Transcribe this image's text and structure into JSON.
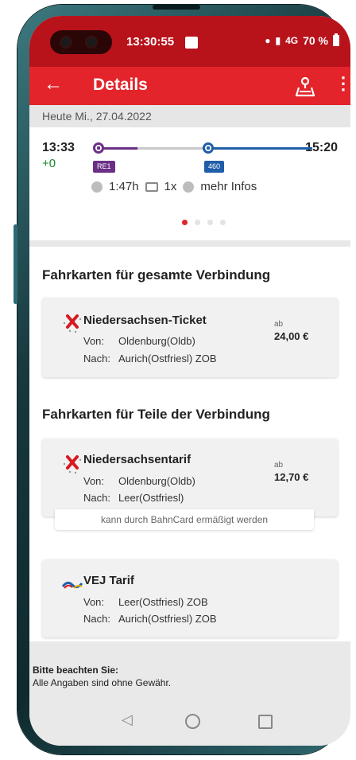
{
  "status_bar": {
    "time": "13:30:55",
    "signal": "4G",
    "battery": "70 %"
  },
  "app_bar": {
    "title": "Details",
    "back_icon": "arrow-left-icon",
    "map_icon": "map-person-icon",
    "more_icon": "more-vert-icon"
  },
  "date_label": "Heute Mi., 27.04.2022",
  "connection": {
    "departure": "13:33",
    "delay": "+0",
    "arrival": "15:20",
    "legs": [
      {
        "label": "RE1",
        "color": "#6b2f86"
      },
      {
        "label": "460",
        "color": "#1f5ea8"
      }
    ],
    "duration": "1:47h",
    "transfers": "1x",
    "more_info": "mehr Infos",
    "page_indicator": {
      "count": 4,
      "active": 0
    }
  },
  "section_full": {
    "title": "Fahrkarten für gesamte Verbindung",
    "tickets": [
      {
        "name": "Niedersachsen-Ticket",
        "from_label": "Von:",
        "from": "Oldenburg(Oldb)",
        "to_label": "Nach:",
        "to": "Aurich(Ostfriesl) ZOB",
        "price_prefix": "ab",
        "price": "24,00 €"
      }
    ]
  },
  "section_partial": {
    "title": "Fahrkarten für Teile der Verbindung",
    "tickets": [
      {
        "name": "Niedersachsentarif",
        "from_label": "Von:",
        "from": "Oldenburg(Oldb)",
        "to_label": "Nach:",
        "to": "Leer(Ostfriesl)",
        "price_prefix": "ab",
        "price": "12,70 €",
        "note": "kann durch BahnCard ermäßigt werden"
      },
      {
        "name": "VEJ Tarif",
        "from_label": "Von:",
        "from": "Leer(Ostfriesl) ZOB",
        "to_label": "Nach:",
        "to": "Aurich(Ostfriesl) ZOB"
      }
    ]
  },
  "footer": {
    "note_title": "Bitte beachten Sie:",
    "note_text": "Alle Angaben sind ohne Gewähr."
  },
  "colors": {
    "status_bar": "#b8121b",
    "app_bar": "#e3242b",
    "delay_green": "#168a2f"
  }
}
